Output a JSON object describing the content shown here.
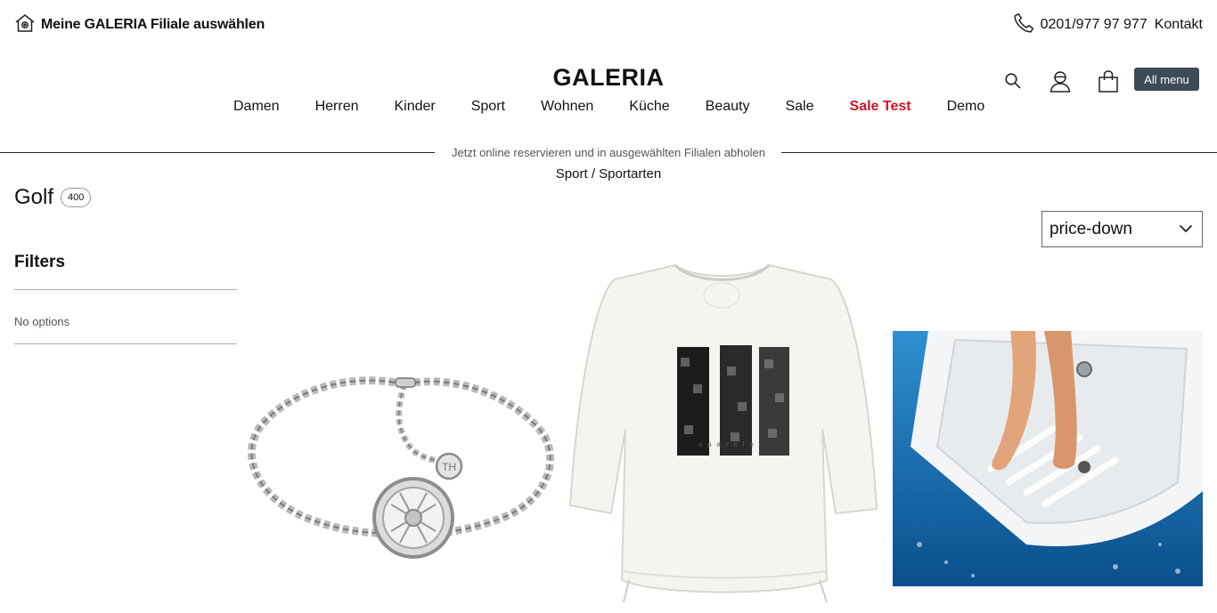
{
  "topbar": {
    "store_label": "Meine GALERIA Filiale auswählen",
    "store_icon": "home-icon",
    "phone": "0201/977 97 977",
    "contact_label": "Kontakt",
    "phone_icon": "phone-icon"
  },
  "header": {
    "logo": "GALERIA",
    "all_menu": "All menu",
    "icons": [
      "search-icon",
      "user-icon",
      "cart-icon"
    ]
  },
  "nav": {
    "items": [
      {
        "label": "Damen"
      },
      {
        "label": "Herren"
      },
      {
        "label": "Kinder"
      },
      {
        "label": "Sport"
      },
      {
        "label": "Wohnen"
      },
      {
        "label": "Küche"
      },
      {
        "label": "Beauty"
      },
      {
        "label": "Sale"
      },
      {
        "label": "Sale Test",
        "highlight": true
      },
      {
        "label": "Demo"
      }
    ],
    "highlight_color": "#d11526"
  },
  "banner": {
    "text": "Jetzt online reservieren und in ausgewählten Filialen abholen"
  },
  "breadcrumb": {
    "text": "Sport / Sportarten"
  },
  "category": {
    "title": "Golf",
    "count": "400"
  },
  "sort": {
    "value": "price-down"
  },
  "filters": {
    "title": "Filters",
    "empty_text": "No options"
  },
  "products": [
    {
      "name": "silver-bracelet-image"
    },
    {
      "name": "white-shirt-image"
    },
    {
      "name": "bathtub-mat-image"
    }
  ],
  "colors": {
    "accent_dark": "#3d4a57",
    "sale": "#d11526"
  }
}
